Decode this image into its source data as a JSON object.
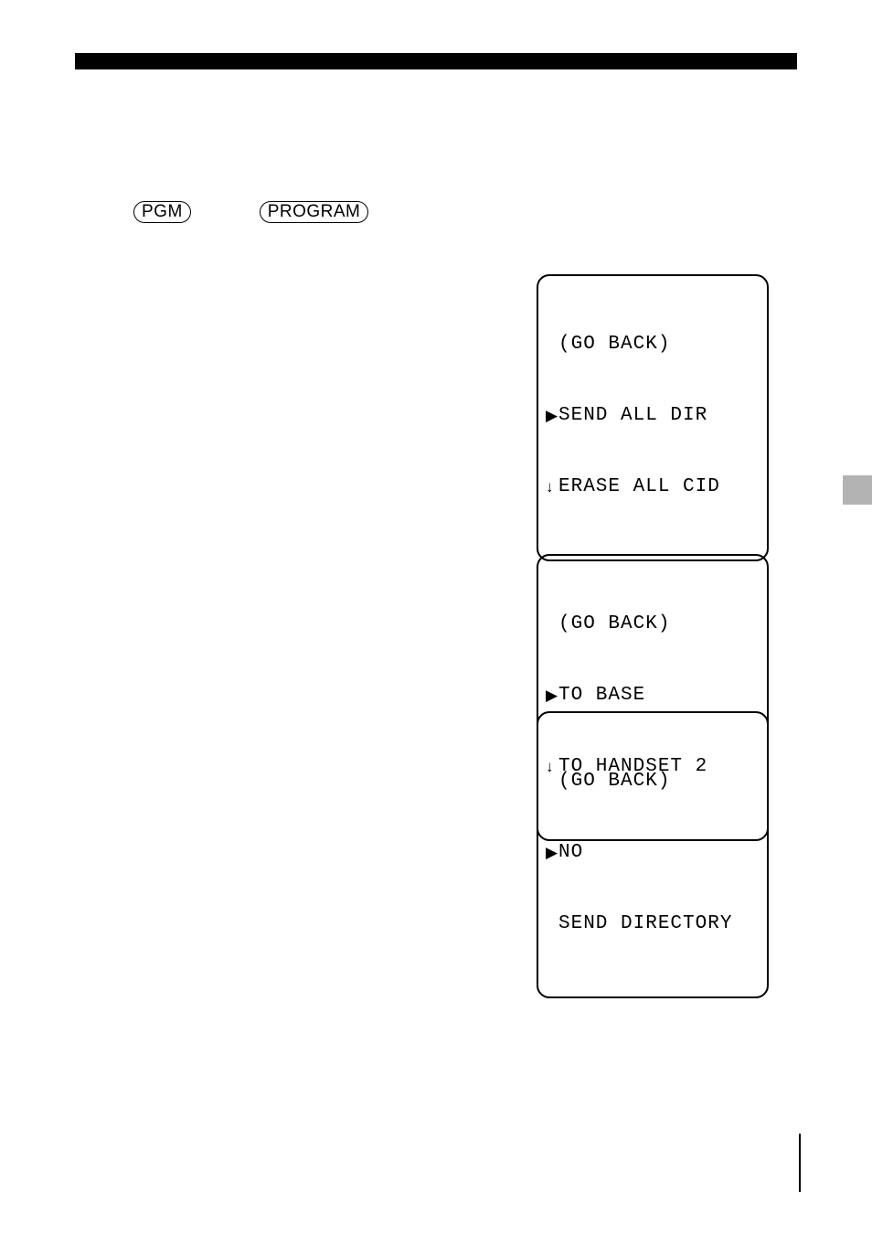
{
  "buttons": {
    "pgm": "PGM",
    "program": "PROGRAM"
  },
  "lcd1": {
    "row1": {
      "icon": "",
      "text": "(GO BACK)"
    },
    "row2": {
      "icon": "▶",
      "text": "SEND ALL DIR"
    },
    "row3": {
      "icon": "↓",
      "text": "ERASE ALL CID"
    }
  },
  "lcd2": {
    "row1": {
      "icon": "",
      "text": "(GO BACK)"
    },
    "row2": {
      "icon": "▶",
      "text": "TO BASE"
    },
    "row3": {
      "icon": "↓",
      "text": "TO HANDSET 2"
    }
  },
  "lcd3": {
    "row1": {
      "icon": "",
      "text": "(GO BACK)"
    },
    "row2": {
      "icon": "▶",
      "text": "NO"
    },
    "row3": {
      "icon": "",
      "text": "SEND DIRECTORY"
    }
  }
}
